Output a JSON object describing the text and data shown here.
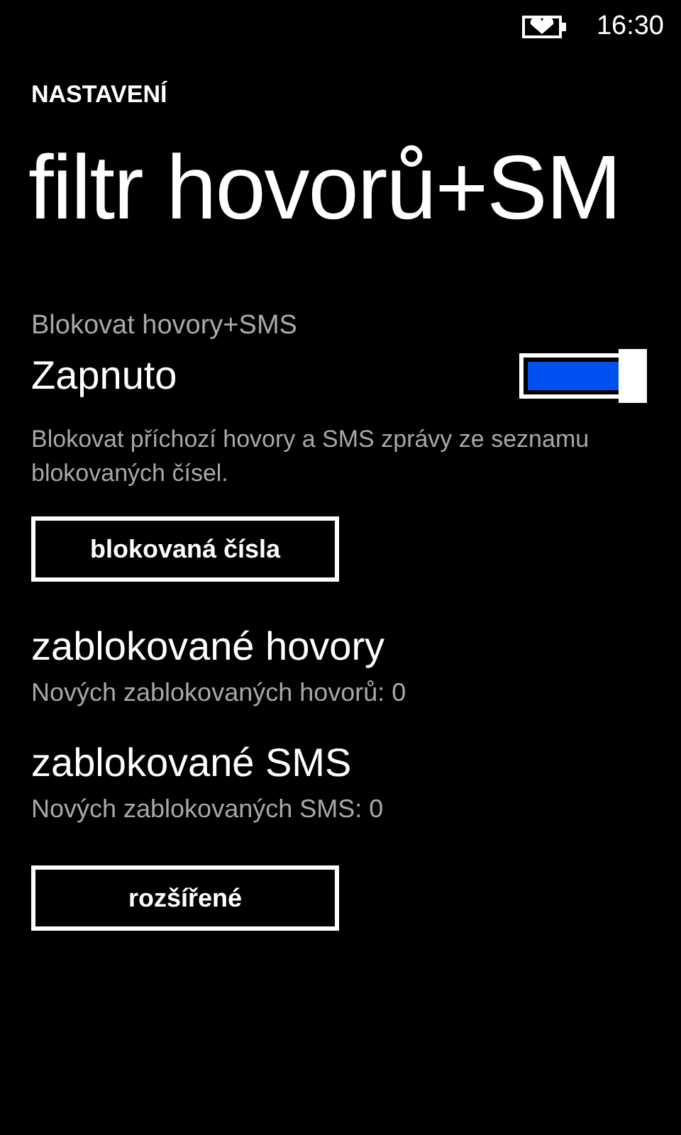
{
  "status_bar": {
    "time": "16:30"
  },
  "header": {
    "app_title": "NASTAVENÍ",
    "page_title": "filtr hovorů+SM"
  },
  "block_setting": {
    "label": "Blokovat hovory+SMS",
    "value": "Zapnuto",
    "on": true,
    "description": "Blokovat příchozí hovory a SMS zprávy ze seznamu blokovaných čísel."
  },
  "blocked_numbers_button": "blokovaná čísla",
  "sections": [
    {
      "title": "zablokované hovory",
      "subtitle": "Nových zablokovaných hovorů: 0"
    },
    {
      "title": "zablokované SMS",
      "subtitle": "Nových zablokovaných SMS: 0"
    }
  ],
  "advanced_button": "rozšířené"
}
